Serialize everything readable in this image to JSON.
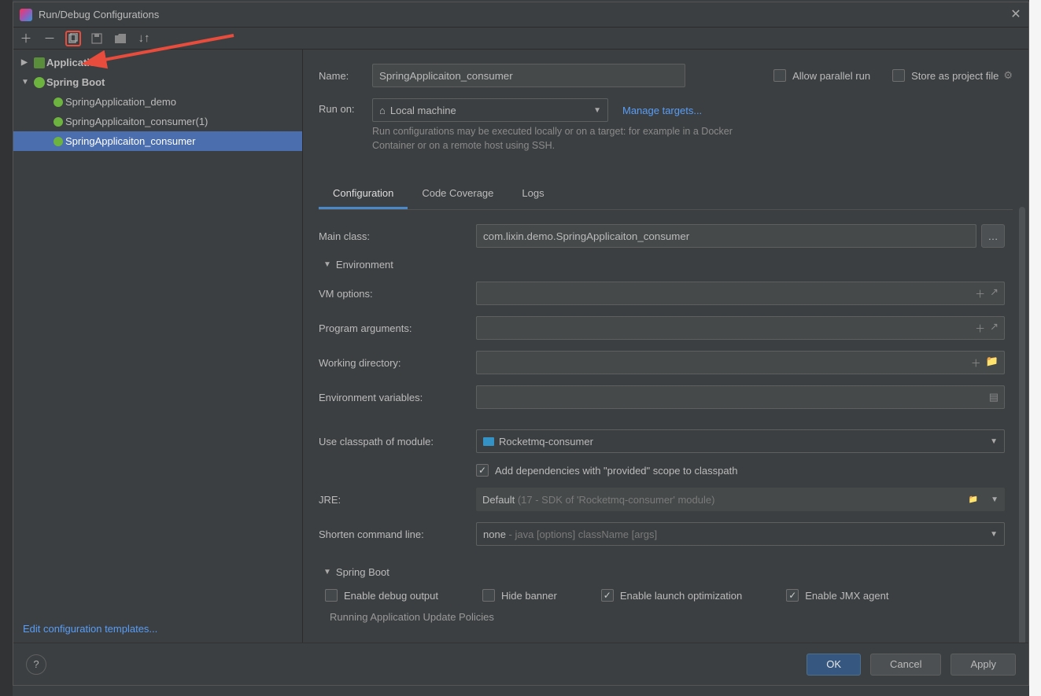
{
  "dialog": {
    "title": "Run/Debug Configurations"
  },
  "tree": {
    "app_group": "Application",
    "spring_group": "Spring Boot",
    "children": [
      "SpringApplication_demo",
      "SpringApplicaiton_consumer(1)",
      "SpringApplicaiton_consumer"
    ]
  },
  "sidebar": {
    "edit_templates": "Edit configuration templates..."
  },
  "form": {
    "name_label": "Name:",
    "name_value": "SpringApplicaiton_consumer",
    "allow_parallel": "Allow parallel run",
    "store_as_project": "Store as project file",
    "runon_label": "Run on:",
    "runon_value": "Local machine",
    "manage_targets": "Manage targets...",
    "runon_hint": "Run configurations may be executed locally or on a target: for example in a Docker Container or on a remote host using SSH.",
    "tabs": [
      "Configuration",
      "Code Coverage",
      "Logs"
    ],
    "main_class_label": "Main class:",
    "main_class_value": "com.lixin.demo.SpringApplicaiton_consumer",
    "env_section": "Environment",
    "vm_options_label": "VM options:",
    "program_args_label": "Program arguments:",
    "working_dir_label": "Working directory:",
    "env_vars_label": "Environment variables:",
    "classpath_label": "Use classpath of module:",
    "classpath_value": "Rocketmq-consumer",
    "add_provided": "Add dependencies with \"provided\" scope to classpath",
    "jre_label": "JRE:",
    "jre_default": "Default",
    "jre_hint": "(17 - SDK of 'Rocketmq-consumer' module)",
    "shorten_label": "Shorten command line:",
    "shorten_value": "none",
    "shorten_hint": "- java [options] className [args]",
    "spring_section": "Spring Boot",
    "enable_debug": "Enable debug output",
    "hide_banner": "Hide banner",
    "enable_launch_opt": "Enable launch optimization",
    "enable_jmx": "Enable JMX agent",
    "update_policies": "Running Application Update Policies"
  },
  "buttons": {
    "ok": "OK",
    "cancel": "Cancel",
    "apply": "Apply"
  }
}
